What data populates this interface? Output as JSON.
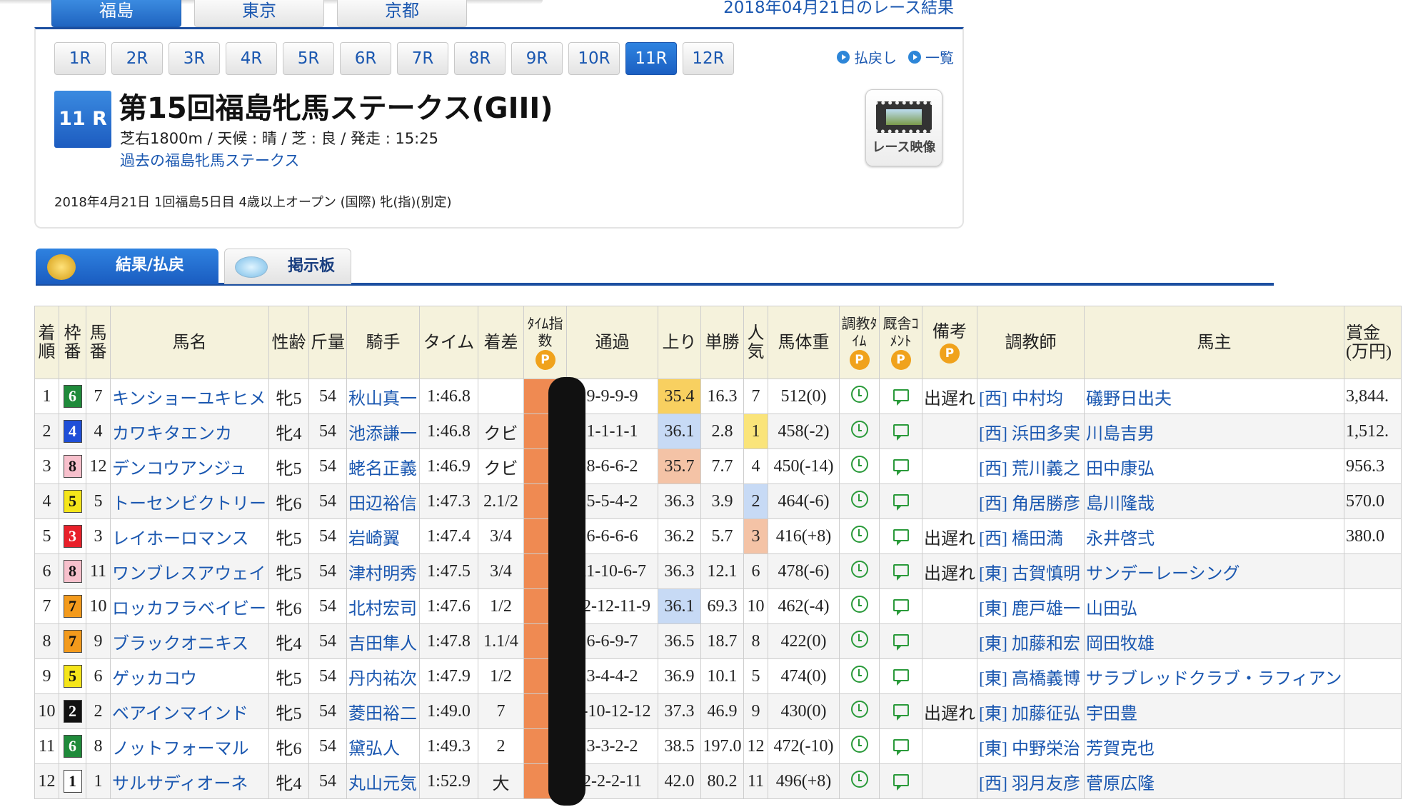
{
  "venue_tabs": [
    "福島",
    "東京",
    "京都"
  ],
  "venue_active": 0,
  "date_title": "2018年04月21日のレース結果",
  "race_nav": [
    "1R",
    "2R",
    "3R",
    "4R",
    "5R",
    "6R",
    "7R",
    "8R",
    "9R",
    "10R",
    "11R",
    "12R"
  ],
  "race_nav_active": 10,
  "links": {
    "payout": "払戻し",
    "list": "一覧"
  },
  "race": {
    "badge": "11 R",
    "title": "第15回福島牝馬ステークス(GIII)",
    "conditions": "芝右1800m / 天候 : 晴 / 芝 : 良 / 発走 : 15:25",
    "past_link": "過去の福島牝馬ステークス",
    "meta": "2018年4月21日 1回福島5日目 4歳以上オープン (国際) 牝(指)(別定)",
    "video_label": "レース映像"
  },
  "result_tabs": {
    "results": "結果/払戻",
    "board": "掲示板"
  },
  "table": {
    "headers": {
      "finish": "着順",
      "frame": "枠番",
      "number": "馬番",
      "name": "馬名",
      "sexage": "性齢",
      "weight": "斤量",
      "jockey": "騎手",
      "time": "タイム",
      "margin": "着差",
      "time_index": "ﾀｲﾑ指数",
      "passing": "通過",
      "last3f": "上り",
      "odds": "単勝",
      "pop": "人気",
      "body": "馬体重",
      "train_time": "調教ﾀｲﾑ",
      "stable_comment": "厩舎ｺﾒﾝﾄ",
      "remarks": "備考",
      "trainer": "調教師",
      "owner": "馬主",
      "prize": "賞金(万円)"
    },
    "p_badge": "P",
    "rows": [
      {
        "finish": "1",
        "frame": "6",
        "number": "7",
        "name": "キンショーユキヒメ",
        "sexage": "牝5",
        "weight": "54",
        "jockey": "秋山真一",
        "time": "1:46.8",
        "margin": "",
        "passing": "9-9-9-9",
        "last3f": "35.4",
        "odds": "16.3",
        "pop": "7",
        "body": "512(0)",
        "remarks": "出遅れ",
        "trainer": "[西] 中村均",
        "owner": "礒野日出夫",
        "prize": "3,844."
      },
      {
        "finish": "2",
        "frame": "4",
        "number": "4",
        "name": "カワキタエンカ",
        "sexage": "牝4",
        "weight": "54",
        "jockey": "池添謙一",
        "time": "1:46.8",
        "margin": "クビ",
        "passing": "1-1-1-1",
        "last3f": "36.1",
        "odds": "2.8",
        "pop": "1",
        "body": "458(-2)",
        "remarks": "",
        "trainer": "[西] 浜田多実",
        "owner": "川島吉男",
        "prize": "1,512."
      },
      {
        "finish": "3",
        "frame": "8",
        "number": "12",
        "name": "デンコウアンジュ",
        "sexage": "牝5",
        "weight": "54",
        "jockey": "蛯名正義",
        "time": "1:46.9",
        "margin": "クビ",
        "passing": "8-6-6-2",
        "last3f": "35.7",
        "odds": "7.7",
        "pop": "4",
        "body": "450(-14)",
        "remarks": "",
        "trainer": "[西] 荒川義之",
        "owner": "田中康弘",
        "prize": "956.3"
      },
      {
        "finish": "4",
        "frame": "5",
        "number": "5",
        "name": "トーセンビクトリー",
        "sexage": "牝6",
        "weight": "54",
        "jockey": "田辺裕信",
        "time": "1:47.3",
        "margin": "2.1/2",
        "passing": "5-5-4-2",
        "last3f": "36.3",
        "odds": "3.9",
        "pop": "2",
        "body": "464(-6)",
        "remarks": "",
        "trainer": "[西] 角居勝彦",
        "owner": "島川隆哉",
        "prize": "570.0"
      },
      {
        "finish": "5",
        "frame": "3",
        "number": "3",
        "name": "レイホーロマンス",
        "sexage": "牝5",
        "weight": "54",
        "jockey": "岩崎翼",
        "time": "1:47.4",
        "margin": "3/4",
        "passing": "6-6-6-6",
        "last3f": "36.2",
        "odds": "5.7",
        "pop": "3",
        "body": "416(+8)",
        "remarks": "出遅れ",
        "trainer": "[西] 橋田満",
        "owner": "永井啓弍",
        "prize": "380.0"
      },
      {
        "finish": "6",
        "frame": "8",
        "number": "11",
        "name": "ワンブレスアウェイ",
        "sexage": "牝5",
        "weight": "54",
        "jockey": "津村明秀",
        "time": "1:47.5",
        "margin": "3/4",
        "passing": "11-10-6-7",
        "last3f": "36.3",
        "odds": "12.1",
        "pop": "6",
        "body": "478(-6)",
        "remarks": "出遅れ",
        "trainer": "[東] 古賀慎明",
        "owner": "サンデーレーシング",
        "prize": ""
      },
      {
        "finish": "7",
        "frame": "7",
        "number": "10",
        "name": "ロッカフラベイビー",
        "sexage": "牝6",
        "weight": "54",
        "jockey": "北村宏司",
        "time": "1:47.6",
        "margin": "1/2",
        "passing": "12-12-11-9",
        "last3f": "36.1",
        "odds": "69.3",
        "pop": "10",
        "body": "462(-4)",
        "remarks": "",
        "trainer": "[東] 鹿戸雄一",
        "owner": "山田弘",
        "prize": ""
      },
      {
        "finish": "8",
        "frame": "7",
        "number": "9",
        "name": "ブラックオニキス",
        "sexage": "牝4",
        "weight": "54",
        "jockey": "吉田隼人",
        "time": "1:47.8",
        "margin": "1.1/4",
        "passing": "6-6-9-7",
        "last3f": "36.5",
        "odds": "18.7",
        "pop": "8",
        "body": "422(0)",
        "remarks": "",
        "trainer": "[東] 加藤和宏",
        "owner": "岡田牧雄",
        "prize": ""
      },
      {
        "finish": "9",
        "frame": "5",
        "number": "6",
        "name": "ゲッカコウ",
        "sexage": "牝5",
        "weight": "54",
        "jockey": "丹内祐次",
        "time": "1:47.9",
        "margin": "1/2",
        "passing": "3-4-4-2",
        "last3f": "36.9",
        "odds": "10.1",
        "pop": "5",
        "body": "474(0)",
        "remarks": "",
        "trainer": "[東] 高橋義博",
        "owner": "サラブレッドクラブ・ラフィアン",
        "prize": ""
      },
      {
        "finish": "10",
        "frame": "2",
        "number": "2",
        "name": "ベアインマインド",
        "sexage": "牝5",
        "weight": "54",
        "jockey": "菱田裕二",
        "time": "1:49.0",
        "margin": "7",
        "passing": "9-10-12-12",
        "last3f": "37.3",
        "odds": "46.9",
        "pop": "9",
        "body": "430(0)",
        "remarks": "出遅れ",
        "trainer": "[東] 加藤征弘",
        "owner": "宇田豊",
        "prize": ""
      },
      {
        "finish": "11",
        "frame": "6",
        "number": "8",
        "name": "ノットフォーマル",
        "sexage": "牝6",
        "weight": "54",
        "jockey": "黛弘人",
        "time": "1:49.3",
        "margin": "2",
        "passing": "3-3-2-2",
        "last3f": "38.5",
        "odds": "197.0",
        "pop": "12",
        "body": "472(-10)",
        "remarks": "",
        "trainer": "[東] 中野栄治",
        "owner": "芳賀克也",
        "prize": ""
      },
      {
        "finish": "12",
        "frame": "1",
        "number": "1",
        "name": "サルサディオーネ",
        "sexage": "牝4",
        "weight": "54",
        "jockey": "丸山元気",
        "time": "1:52.9",
        "margin": "大",
        "passing": "2-2-2-11",
        "last3f": "42.0",
        "odds": "80.2",
        "pop": "11",
        "body": "496(+8)",
        "remarks": "",
        "trainer": "[西] 羽月友彦",
        "owner": "菅原広隆",
        "prize": ""
      }
    ]
  },
  "colors": {
    "frame_1": "#ffffff",
    "frame_2": "#111111",
    "frame_3": "#e8202a",
    "frame_4": "#1f4fd8",
    "frame_5": "#f5e51a",
    "frame_6": "#1f8a3a",
    "frame_7": "#f39a1c",
    "frame_8": "#f7c0cc",
    "last3f_first": "#f8d060",
    "last3f_second": "#f4c3a6",
    "last3f_third": "#c7daf5",
    "pop_first": "#fae47a",
    "pop_second": "#c7daf5",
    "pop_third": "#f4c3a6",
    "accent": "#1f64c0",
    "header_bg": "#f5f2dc"
  }
}
